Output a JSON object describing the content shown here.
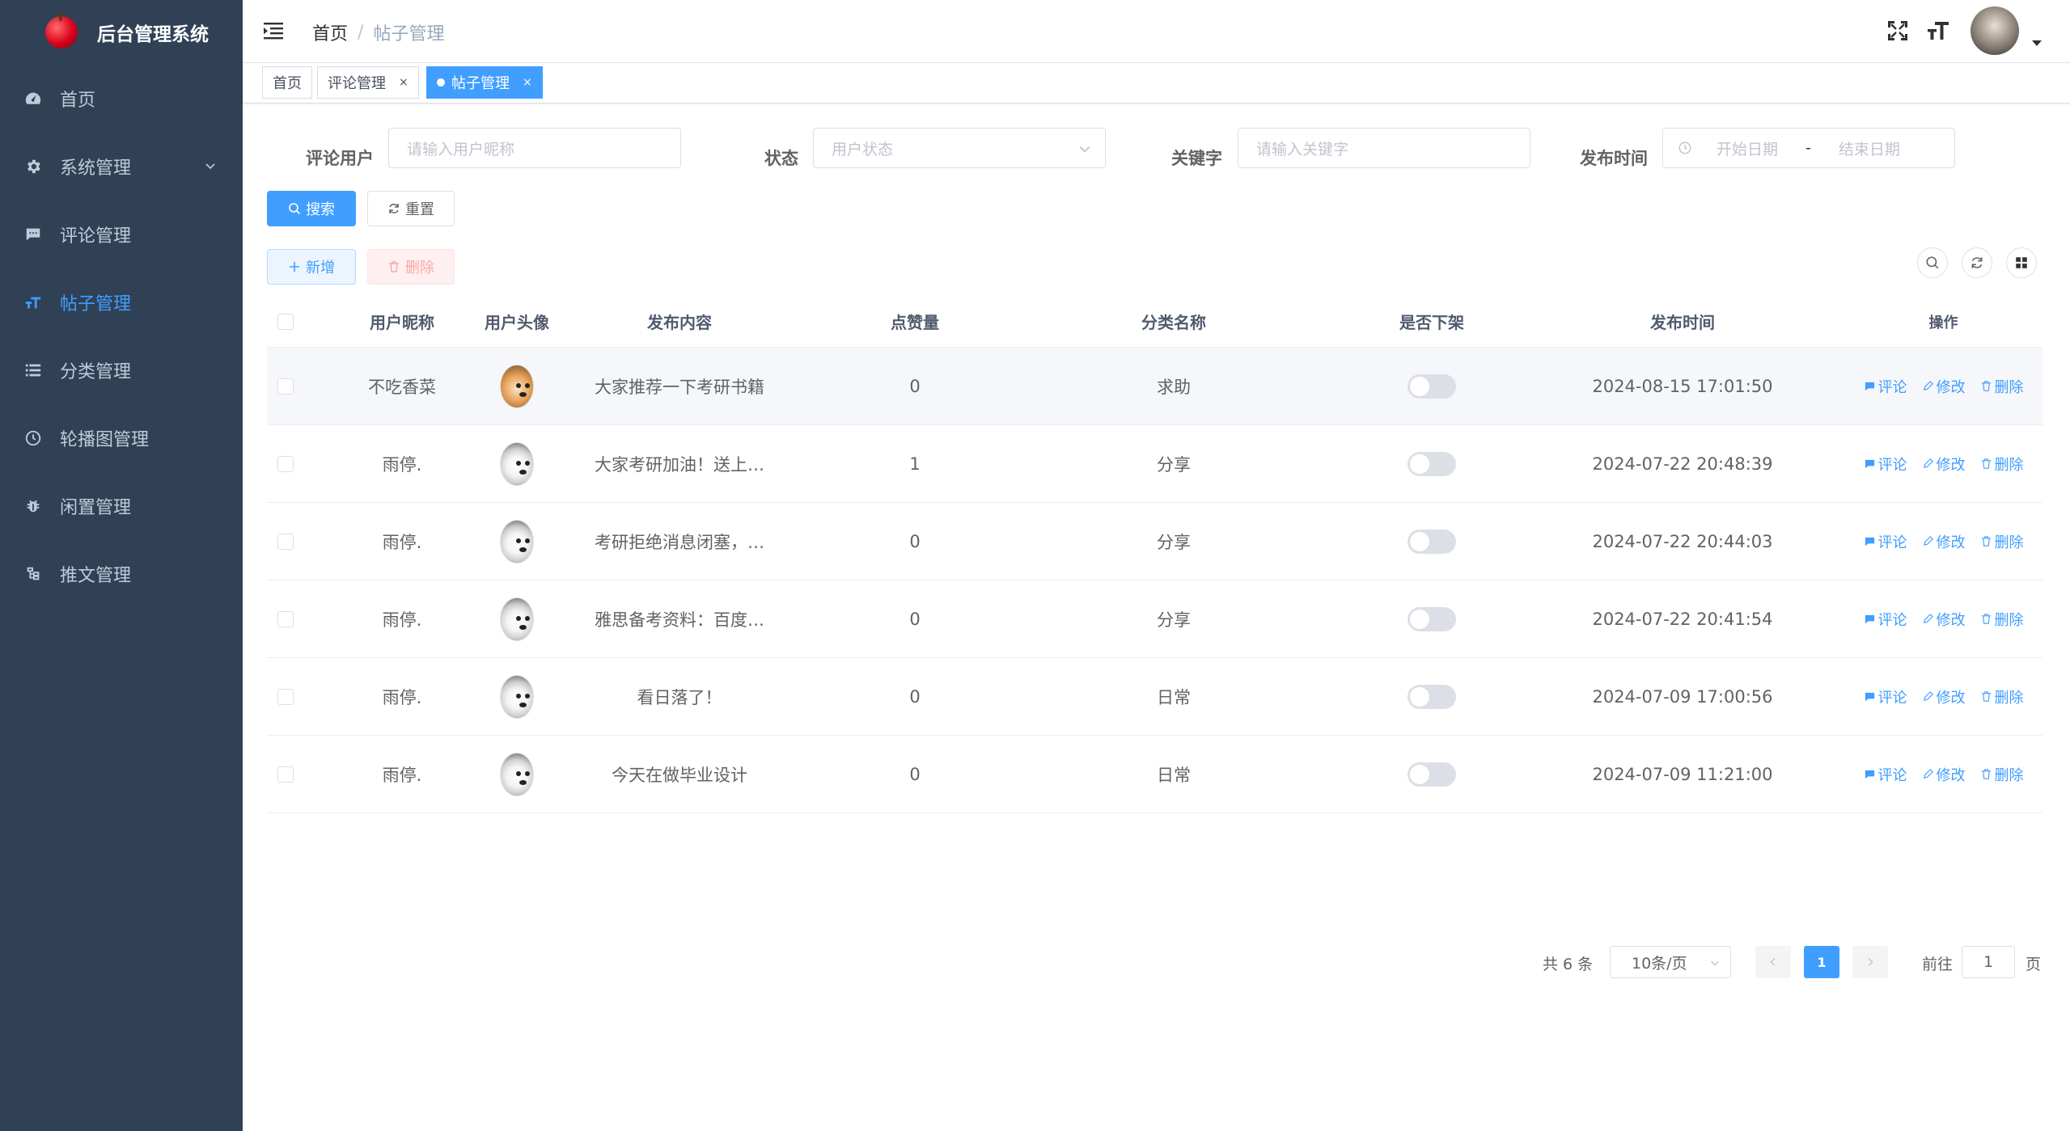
{
  "app": {
    "title": "后台管理系统"
  },
  "sidebar": {
    "items": [
      {
        "label": "首页",
        "icon": "dashboard-icon"
      },
      {
        "label": "系统管理",
        "icon": "gear-icon"
      },
      {
        "label": "评论管理",
        "icon": "message-icon"
      },
      {
        "label": "帖子管理",
        "icon": "text-size-icon"
      },
      {
        "label": "分类管理",
        "icon": "list-icon"
      },
      {
        "label": "轮播图管理",
        "icon": "clock-icon"
      },
      {
        "label": "闲置管理",
        "icon": "bug-icon"
      },
      {
        "label": "推文管理",
        "icon": "tree-icon"
      }
    ],
    "active_color": "#409eff",
    "background": "#304156"
  },
  "header": {
    "breadcrumb": {
      "home": "首页",
      "sep": "/",
      "current": "帖子管理"
    }
  },
  "tags": {
    "items": [
      {
        "label": "首页"
      },
      {
        "label": "评论管理",
        "close": "×"
      },
      {
        "label": "帖子管理",
        "close": "×"
      }
    ]
  },
  "filters": {
    "user_label": "评论用户",
    "user_placeholder": "请输入用户昵称",
    "status_label": "状态",
    "status_placeholder": "用户状态",
    "keyword_label": "关键字",
    "keyword_placeholder": "请输入关键字",
    "date_label": "发布时间",
    "date_start_placeholder": "开始日期",
    "date_sep": "-",
    "date_end_placeholder": "结束日期",
    "search_label": "搜索",
    "reset_label": "重置"
  },
  "toolbar": {
    "add_label": "新增",
    "delete_label": "删除"
  },
  "table": {
    "headers": [
      "用户昵称",
      "用户头像",
      "发布内容",
      "点赞量",
      "分类名称",
      "是否下架",
      "发布时间",
      "操作"
    ],
    "rows": [
      {
        "nickname": "不吃香菜",
        "content": "大家推荐一下考研书籍",
        "likes": "0",
        "category": "求助",
        "time": "2024-08-15 17:01:50"
      },
      {
        "nickname": "雨停.",
        "content": "大家考研加油！送上…",
        "likes": "1",
        "category": "分享",
        "time": "2024-07-22 20:48:39"
      },
      {
        "nickname": "雨停.",
        "content": "考研拒绝消息闭塞，…",
        "likes": "0",
        "category": "分享",
        "time": "2024-07-22 20:44:03"
      },
      {
        "nickname": "雨停.",
        "content": "雅思备考资料：百度…",
        "likes": "0",
        "category": "分享",
        "time": "2024-07-22 20:41:54"
      },
      {
        "nickname": "雨停.",
        "content": "看日落了！",
        "likes": "0",
        "category": "日常",
        "time": "2024-07-09 17:00:56"
      },
      {
        "nickname": "雨停.",
        "content": "今天在做毕业设计",
        "likes": "0",
        "category": "日常",
        "time": "2024-07-09 11:21:00"
      }
    ],
    "op_comment": "评论",
    "op_edit": "修改",
    "op_delete": "删除"
  },
  "pagination": {
    "total_text": "共 6 条",
    "page_size": "10条/页",
    "current_page": "1",
    "goto_prefix": "前往",
    "goto_value": "1",
    "goto_suffix": "页"
  }
}
